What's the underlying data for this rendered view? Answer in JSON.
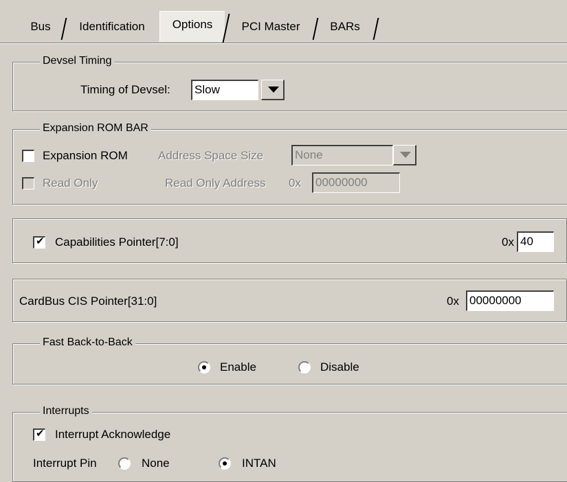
{
  "tabs": [
    "Bus",
    "Identification",
    "Options",
    "PCI Master",
    "BARs"
  ],
  "active_tab": "Options",
  "devsel": {
    "group_label": "Devsel Timing",
    "timing_label": "Timing of Devsel:",
    "timing_value": "Slow"
  },
  "expansion_rom": {
    "group_label": "Expansion ROM BAR",
    "checkbox_label": "Expansion ROM",
    "checked": false,
    "size_label": "Address Space Size",
    "size_value": "None",
    "read_only_label": "Read Only",
    "read_only_address_label": "Read Only Address",
    "hex_prefix": "0x",
    "read_only_address_value": "00000000"
  },
  "capabilities": {
    "checkbox_label": "Capabilities Pointer[7:0]",
    "checked": true,
    "hex_prefix": "0x",
    "value": "40"
  },
  "cardbus": {
    "label": "CardBus CIS Pointer[31:0]",
    "hex_prefix": "0x",
    "value": "00000000"
  },
  "fast_b2b": {
    "group_label": "Fast Back-to-Back",
    "enable_label": "Enable",
    "disable_label": "Disable",
    "selected": "Enable"
  },
  "interrupts": {
    "group_label": "Interrupts",
    "ack_label": "Interrupt Acknowledge",
    "ack_checked": true,
    "pin_label": "Interrupt Pin",
    "none_label": "None",
    "intan_label": "INTAN",
    "selected": "INTAN"
  }
}
